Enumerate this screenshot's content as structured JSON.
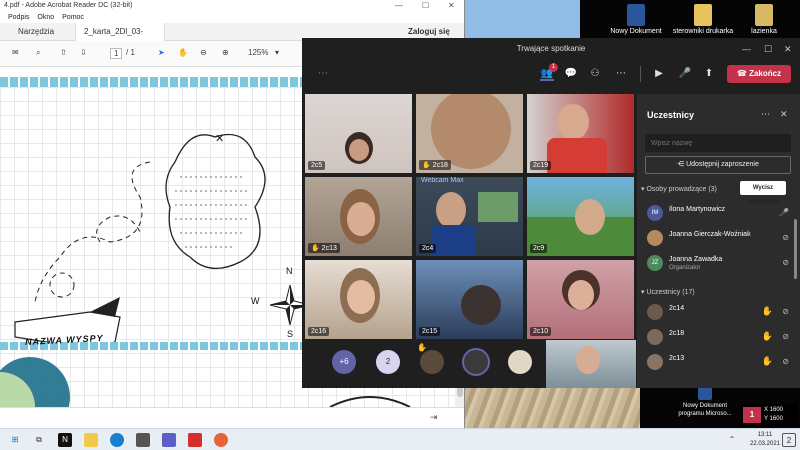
{
  "acrobat": {
    "title": "4.pdf - Adobe Acrobat Reader DC (32-bit)",
    "menu": [
      "Podpis",
      "Okno",
      "Pomoc"
    ],
    "tabs": [
      "Narzędzia",
      "2_karta_2Dl_03-04..."
    ],
    "signin": "Zaloguj się",
    "page_current": "1",
    "page_total": "/ 1",
    "zoom": "125%",
    "map_label": "NAZWA WYSPY",
    "compass": {
      "north": "N",
      "south": "S",
      "west": "W"
    }
  },
  "teams": {
    "title": "Trwające spotkanie",
    "leave_label": "Zakończ",
    "participants_badge": "1",
    "tiles": [
      {
        "label": "2c5",
        "hand": false
      },
      {
        "label": "2c18",
        "hand": true
      },
      {
        "label": "2c19",
        "hand": false
      },
      {
        "label": "2c13",
        "hand": true
      },
      {
        "label": "2c4",
        "hand": false
      },
      {
        "label": "2c9",
        "hand": false
      },
      {
        "label": "2c16",
        "hand": false
      },
      {
        "label": "2c15",
        "hand": false
      },
      {
        "label": "2c10",
        "hand": false
      }
    ],
    "dock": {
      "overflow": "+6",
      "count": "2"
    },
    "webcam_overlay": "Webcam Max"
  },
  "panel": {
    "title": "Uczestnicy",
    "search_placeholder": "Wpisz nazwę",
    "share_label": "Udostępnij zaproszenie",
    "presenters_label": "Osoby prowadzące (3)",
    "mute_all_label": "Wycisz wszystkich",
    "presenters": [
      {
        "name": "Ilona Martynowicz",
        "sub": "",
        "initials": "IM",
        "color": "#4a5a9a"
      },
      {
        "name": "Joanna Gierczak-Woźniak",
        "sub": "",
        "initials": "",
        "color": "#b38a5c"
      },
      {
        "name": "Joanna Zawadka",
        "sub": "Organizator",
        "initials": "JZ",
        "color": "#4f8a5c"
      }
    ],
    "attendees_label": "Uczestnicy (17)",
    "attendees": [
      {
        "name": "2c14",
        "hand": true
      },
      {
        "name": "2c18",
        "hand": true
      },
      {
        "name": "2c13",
        "hand": true
      }
    ]
  },
  "desktop": {
    "icons": [
      "Nowy Dokument",
      "sterowniki drukarka",
      "lazienka"
    ],
    "bottom_icon": "Nowy Dokument programu Microso..."
  },
  "overlay": {
    "x": "X 1600",
    "y": "Y 1600"
  },
  "taskbar": {
    "time": "13:11",
    "date": "22.03.2021",
    "notif_count": "2"
  },
  "colors": {
    "leave": "#c4314b",
    "teams_bg": "#1f1f1f",
    "panel_bg": "#2d2c2c",
    "accent": "#6264a7"
  }
}
